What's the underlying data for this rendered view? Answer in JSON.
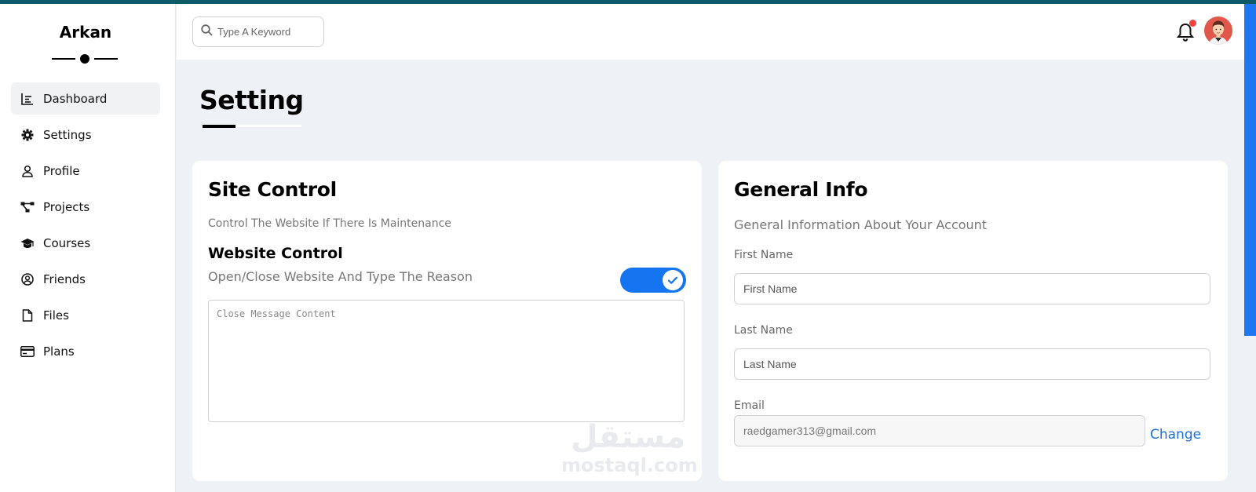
{
  "brand": {
    "name": "Arkan"
  },
  "sidebar": {
    "items": [
      {
        "label": "Dashboard",
        "icon": "chart-icon",
        "active": true
      },
      {
        "label": "Settings",
        "icon": "gear-icon",
        "active": false
      },
      {
        "label": "Profile",
        "icon": "user-icon",
        "active": false
      },
      {
        "label": "Projects",
        "icon": "diagram-icon",
        "active": false
      },
      {
        "label": "Courses",
        "icon": "graduation-cap-icon",
        "active": false
      },
      {
        "label": "Friends",
        "icon": "user-circle-icon",
        "active": false
      },
      {
        "label": "Files",
        "icon": "file-icon",
        "active": false
      },
      {
        "label": "Plans",
        "icon": "credit-card-icon",
        "active": false
      }
    ]
  },
  "header": {
    "search_placeholder": "Type A Keyword",
    "has_notification": true
  },
  "page": {
    "title": "Setting"
  },
  "site_control": {
    "title": "Site Control",
    "subtitle": "Control The Website If There Is Maintenance",
    "website_control_title": "Website Control",
    "website_control_sub": "Open/Close Website And Type The Reason",
    "toggle_on": true,
    "message_placeholder": "Close Message Content"
  },
  "general_info": {
    "title": "General Info",
    "subtitle": "General Information About Your Account",
    "first_name_label": "First Name",
    "first_name_placeholder": "First Name",
    "last_name_label": "Last Name",
    "last_name_placeholder": "Last Name",
    "email_label": "Email",
    "email_value": "raedgamer313@gmail.com",
    "change_label": "Change"
  },
  "watermark": {
    "arabic": "مستقل",
    "latin": "mostaql.com"
  },
  "colors": {
    "accent": "#1575f0",
    "top_strip": "#0e5a66",
    "notification_dot": "#f43f3f",
    "avatar_bg": "#e2574c",
    "link": "#1b6fe0"
  }
}
